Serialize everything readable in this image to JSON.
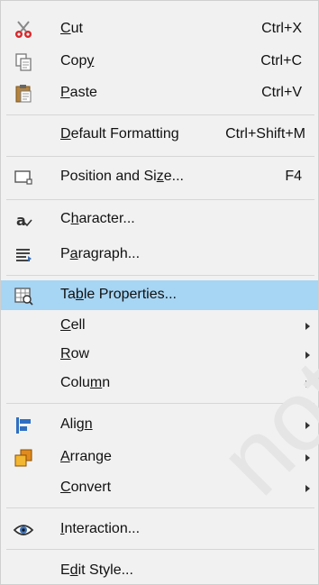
{
  "menu": {
    "items": [
      {
        "id": "cut",
        "before": "",
        "mn": "C",
        "after": "ut",
        "shortcut": "Ctrl+X",
        "icon": "scissors-icon"
      },
      {
        "id": "copy",
        "before": "Cop",
        "mn": "y",
        "after": "",
        "shortcut": "Ctrl+C",
        "icon": "copy-icon"
      },
      {
        "id": "paste",
        "before": "",
        "mn": "P",
        "after": "aste",
        "shortcut": "Ctrl+V",
        "icon": "paste-icon"
      },
      {
        "id": "default-formatting",
        "before": "",
        "mn": "D",
        "after": "efault Formatting",
        "shortcut": "Ctrl+Shift+M"
      },
      {
        "id": "position-size",
        "before": "Position and Si",
        "mn": "z",
        "after": "e...",
        "shortcut": "F4",
        "icon": "position-size-icon"
      },
      {
        "id": "character",
        "before": "C",
        "mn": "h",
        "after": "aracter...",
        "icon": "character-icon"
      },
      {
        "id": "paragraph",
        "before": "P",
        "mn": "a",
        "after": "ragraph...",
        "icon": "paragraph-icon"
      },
      {
        "id": "table-properties",
        "before": "Ta",
        "mn": "b",
        "after": "le Properties...",
        "icon": "table-properties-icon"
      },
      {
        "id": "cell",
        "before": "",
        "mn": "C",
        "after": "ell"
      },
      {
        "id": "row",
        "before": "",
        "mn": "R",
        "after": "ow"
      },
      {
        "id": "column",
        "before": "Colu",
        "mn": "m",
        "after": "n"
      },
      {
        "id": "align",
        "before": "Alig",
        "mn": "n",
        "after": "",
        "icon": "align-icon"
      },
      {
        "id": "arrange",
        "before": "",
        "mn": "A",
        "after": "rrange",
        "icon": "arrange-icon"
      },
      {
        "id": "convert",
        "before": "",
        "mn": "C",
        "after": "onvert"
      },
      {
        "id": "interaction",
        "before": "",
        "mn": "I",
        "after": "nteraction...",
        "icon": "interaction-icon"
      },
      {
        "id": "edit-style",
        "before": "E",
        "mn": "d",
        "after": "it Style..."
      }
    ]
  },
  "watermark": "not",
  "colors": {
    "highlight": "#a7d5f4",
    "background": "#f1f1f1"
  }
}
